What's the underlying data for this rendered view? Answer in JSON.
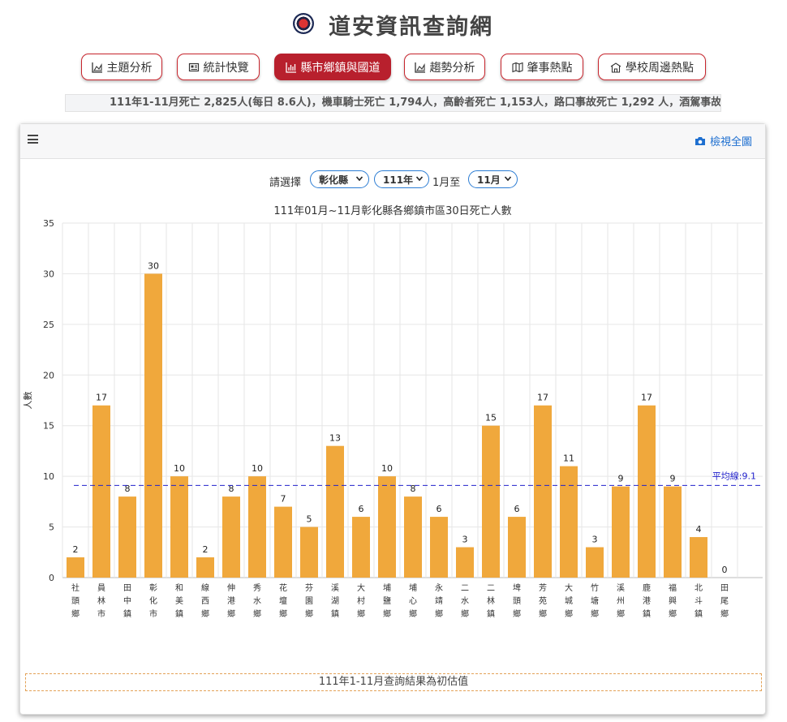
{
  "site": {
    "title": "道安資訊查詢網",
    "logo_icon": "police-emblem-icon"
  },
  "nav": [
    {
      "label": "主題分析",
      "icon": "area-chart-icon",
      "active": false
    },
    {
      "label": "統計快覽",
      "icon": "newspaper-icon",
      "active": false
    },
    {
      "label": "縣市鄉鎮與國道",
      "icon": "bar-chart-icon",
      "active": true
    },
    {
      "label": "趨勢分析",
      "icon": "area-chart-icon",
      "active": false
    },
    {
      "label": "肇事熱點",
      "icon": "map-icon",
      "active": false
    },
    {
      "label": "學校周邊熱點",
      "icon": "school-icon",
      "active": false
    }
  ],
  "ticker": "111年1-11月死亡 2,825人(每日 8.6人)，機車騎士死亡 1,794人，高齡者死亡 1,153人，路口事故死亡 1,292 人，酒駕事故",
  "panel": {
    "view_all": "檢視全圖",
    "view_all_icon": "camera-icon",
    "menu_icon": "hamburger-menu-icon"
  },
  "selector": {
    "label": "請選擇",
    "county": "彰化縣",
    "year": "111年",
    "separator": "1月至",
    "month": "11月"
  },
  "chart_data": {
    "type": "bar",
    "title": "111年01月~11月彰化縣各鄉鎮市區30日死亡人數",
    "ylabel": "人數",
    "xlabel": "",
    "ylim": [
      0,
      35
    ],
    "yticks": [
      0,
      5,
      10,
      15,
      20,
      25,
      30,
      35
    ],
    "grid": true,
    "categories": [
      "社頭鄉",
      "員林市",
      "田中鎮",
      "彰化市",
      "和美鎮",
      "線西鄉",
      "伸港鄉",
      "秀水鄉",
      "花壇鄉",
      "芬園鄉",
      "溪湖鎮",
      "大村鄉",
      "埔鹽鄉",
      "埔心鄉",
      "永靖鄉",
      "二水鄉",
      "二林鎮",
      "埤頭鄉",
      "芳苑鄉",
      "大城鄉",
      "竹塘鄉",
      "溪州鄉",
      "鹿港鎮",
      "福興鄉",
      "北斗鎮",
      "田尾鄉"
    ],
    "values": [
      2,
      17,
      8,
      30,
      10,
      2,
      8,
      10,
      7,
      5,
      13,
      6,
      10,
      8,
      6,
      3,
      15,
      6,
      17,
      11,
      3,
      9,
      17,
      9,
      4,
      0
    ],
    "average": {
      "label": "平均線:9.1",
      "value": 9.1
    },
    "colors": {
      "bar": "#f0a83c",
      "average_line": "#2222cc",
      "grid": "#e6e6e6"
    }
  },
  "footnote": "111年1-11月查詢結果為初估值"
}
